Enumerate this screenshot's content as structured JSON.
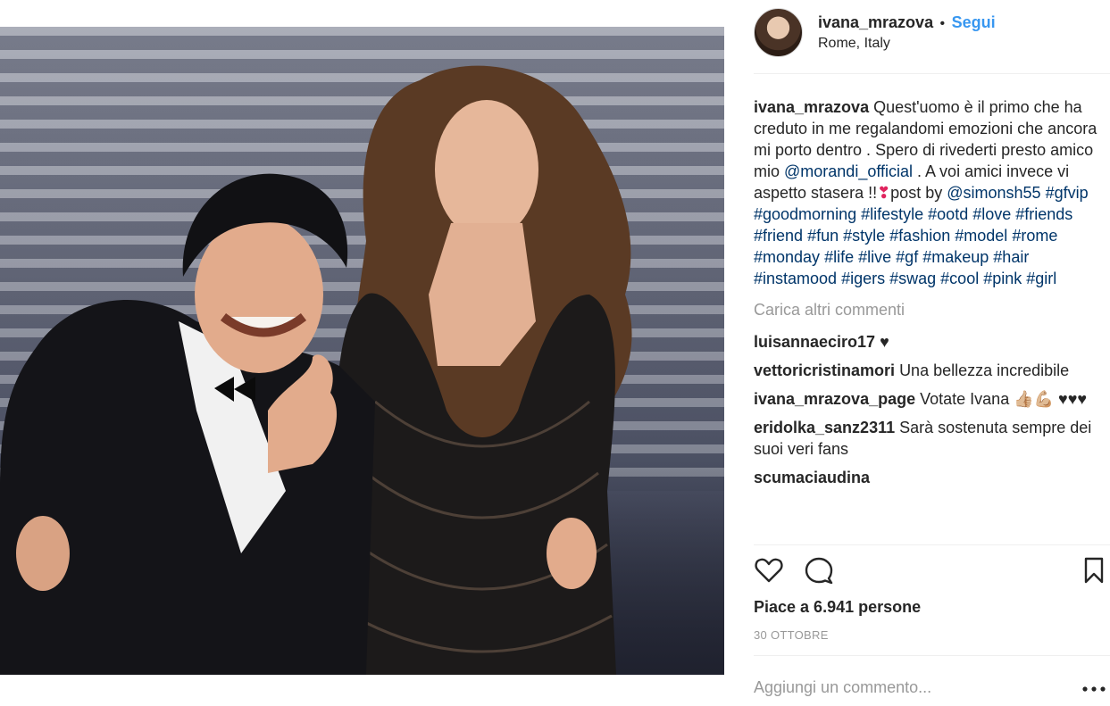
{
  "post": {
    "image_alt": "Foto del post",
    "image_colors": {
      "backdrop": "#6f7384",
      "suit": "#141418",
      "dress": "#1c1a1a",
      "hair": "#5a3a24",
      "skin": "#e6b79a"
    }
  },
  "header": {
    "username": "ivana_mrazova",
    "separator": "•",
    "follow_label": "Segui",
    "location": "Rome, Italy",
    "follow_color": "#3897f0"
  },
  "caption": {
    "username": "ivana_mrazova",
    "text_part1": "Quest'uomo è il primo che ha creduto in me regalandomi emozioni che ancora mi porto dentro . Spero di rivederti presto amico mio ",
    "mention1": "@morandi_official",
    "text_part2": " . A voi amici invece vi aspetto stasera !!",
    "heart_emoji": "❣",
    "text_part3": "post by ",
    "mention2": "@simonsh55",
    "hashtags": [
      "#gfvip",
      "#goodmorning",
      "#lifestyle",
      "#ootd",
      "#love",
      "#friends",
      "#friend",
      "#fun",
      "#style",
      "#fashion",
      "#model",
      "#rome",
      "#monday",
      "#life",
      "#live",
      "#gf",
      "#makeup",
      "#hair",
      "#instamood",
      "#igers",
      "#swag",
      "#cool",
      "#pink",
      "#girl"
    ]
  },
  "load_more_label": "Carica altri commenti",
  "comments": [
    {
      "username": "luisannaeciro17",
      "text": "♥"
    },
    {
      "username": "vettoricristinamori",
      "text": "Una bellezza incredibile"
    },
    {
      "username": "ivana_mrazova_page",
      "text": "Votate Ivana 👍🏼💪🏼 ♥♥♥"
    },
    {
      "username": "eridolka_sanz2311",
      "text": "Sarà sostenuta sempre dei suoi veri fans"
    },
    {
      "username": "scumaciaudina",
      "text": ""
    }
  ],
  "actions": {
    "like_icon": "heart-outline-icon",
    "comment_icon": "speech-bubble-icon",
    "save_icon": "bookmark-icon"
  },
  "likes_label": "Piace a 6.941 persone",
  "date_label": "30 OTTOBRE",
  "add_comment_placeholder": "Aggiungi un commento...",
  "more_icon": "ellipsis-icon"
}
